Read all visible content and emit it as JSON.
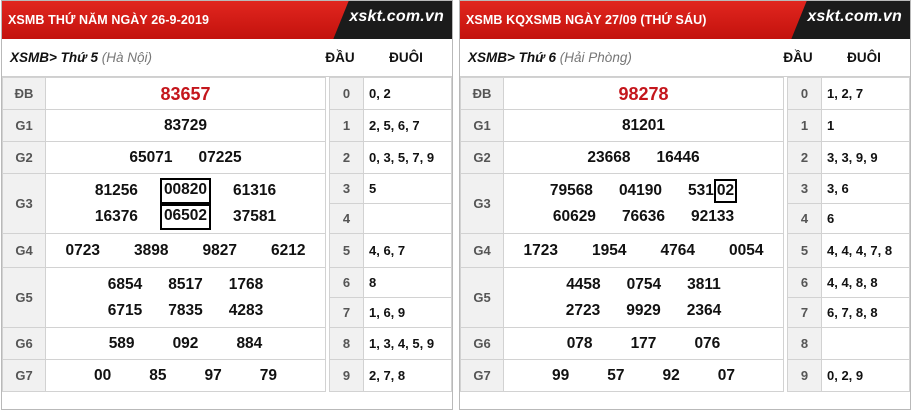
{
  "left": {
    "title": "XSMB THỨ NĂM NGÀY 26-9-2019",
    "logo": "xskt.com.vn",
    "crumb": "XSMB> Thứ 5",
    "crumb_place": "(Hà Nội)",
    "col_dau": "ĐẦU",
    "col_duoi": "ĐUÔI",
    "prizes": {
      "db_label": "ĐB",
      "db": "83657",
      "g1_label": "G1",
      "g1": "83729",
      "g2_label": "G2",
      "g2a": "65071",
      "g2b": "07225",
      "g3_label": "G3",
      "g3a": "81256",
      "g3b": "00820",
      "g3c": "61316",
      "g3d": "16376",
      "g3e": "06502",
      "g3f": "37581",
      "g4_label": "G4",
      "g4a": "0723",
      "g4b": "3898",
      "g4c": "9827",
      "g4d": "6212",
      "g5_label": "G5",
      "g5a": "6854",
      "g5b": "8517",
      "g5c": "1768",
      "g5d": "6715",
      "g5e": "7835",
      "g5f": "4283",
      "g6_label": "G6",
      "g6a": "589",
      "g6b": "092",
      "g6c": "884",
      "g7_label": "G7",
      "g7a": "00",
      "g7b": "85",
      "g7c": "97",
      "g7d": "79"
    },
    "dau": [
      {
        "d": "0",
        "t": "0, 2"
      },
      {
        "d": "1",
        "t": "2, 5, 6, 7"
      },
      {
        "d": "2",
        "t": "0, 3, 5, 7, 9"
      },
      {
        "d": "3",
        "t": "5"
      },
      {
        "d": "4",
        "t": ""
      },
      {
        "d": "5",
        "t": "4, 6, 7"
      },
      {
        "d": "6",
        "t": "8"
      },
      {
        "d": "7",
        "t": "1, 6, 9"
      },
      {
        "d": "8",
        "t": "1, 3, 4, 5, 9"
      },
      {
        "d": "9",
        "t": "2, 7, 8"
      }
    ]
  },
  "right": {
    "title": "XSMB KQXSMB NGÀY 27/09 (THỨ SÁU)",
    "logo": "xskt.com.vn",
    "crumb": "XSMB> Thứ 6",
    "crumb_place": "(Hải Phòng)",
    "col_dau": "ĐẦU",
    "col_duoi": "ĐUÔI",
    "prizes": {
      "db_label": "ĐB",
      "db": "98278",
      "g1_label": "G1",
      "g1": "81201",
      "g2_label": "G2",
      "g2a": "23668",
      "g2b": "16446",
      "g3_label": "G3",
      "g3a": "79568",
      "g3b": "04190",
      "g3c_head": "531",
      "g3c_tail": "02",
      "g3d": "60629",
      "g3e": "76636",
      "g3f": "92133",
      "g4_label": "G4",
      "g4a": "1723",
      "g4b": "1954",
      "g4c": "4764",
      "g4d": "0054",
      "g5_label": "G5",
      "g5a": "4458",
      "g5b": "0754",
      "g5c": "3811",
      "g5d": "2723",
      "g5e": "9929",
      "g5f": "2364",
      "g6_label": "G6",
      "g6a": "078",
      "g6b": "177",
      "g6c": "076",
      "g7_label": "G7",
      "g7a": "99",
      "g7b": "57",
      "g7c": "92",
      "g7d": "07"
    },
    "dau": [
      {
        "d": "0",
        "t": "1, 2, 7"
      },
      {
        "d": "1",
        "t": "1"
      },
      {
        "d": "2",
        "t": "3, 3, 9, 9"
      },
      {
        "d": "3",
        "t": "3, 6"
      },
      {
        "d": "4",
        "t": "6"
      },
      {
        "d": "5",
        "t": "4, 4, 4, 7, 8"
      },
      {
        "d": "6",
        "t": "4, 4, 8, 8"
      },
      {
        "d": "7",
        "t": "6, 7, 8, 8"
      },
      {
        "d": "8",
        "t": ""
      },
      {
        "d": "9",
        "t": "0, 2, 9"
      }
    ]
  },
  "colors": {
    "header_red": "#d01c16",
    "special_red": "#c4161c",
    "logo_band": "#1b1b1b"
  }
}
